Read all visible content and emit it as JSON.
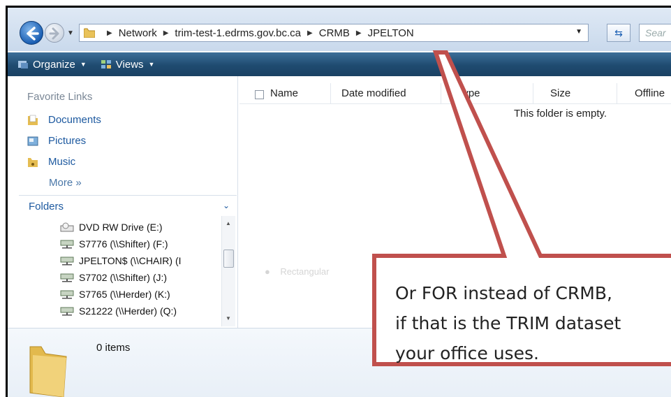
{
  "address_bar": {
    "breadcrumbs": [
      "Network",
      "trim-test-1.edrms.gov.bc.ca",
      "CRMB",
      "JPELTON"
    ],
    "search_placeholder": "Sear",
    "icons": [
      "back-arrow-icon",
      "forward-arrow-icon",
      "folder-icon",
      "refresh-icon"
    ]
  },
  "toolbar": {
    "organize_label": "Organize",
    "views_label": "Views"
  },
  "nav_pane": {
    "favorite_links_title": "Favorite Links",
    "favorites": [
      "Documents",
      "Pictures",
      "Music"
    ],
    "more_label": "More",
    "more_chevron": "»",
    "folders_label": "Folders",
    "tree": [
      "DVD RW Drive (E:)",
      "S7776 (\\\\Shifter) (F:)",
      "JPELTON$ (\\\\CHAIR) (I",
      "S7702 (\\\\Shifter) (J:)",
      "S7765 (\\\\Herder) (K:)",
      "S21222 (\\\\Herder) (Q:)"
    ]
  },
  "content": {
    "columns": [
      "Name",
      "Date modified",
      "Type",
      "Size",
      "Offline"
    ],
    "empty_message": "This folder is empty.",
    "ghost_text": "Rectangular"
  },
  "details_pane": {
    "item_count": "0 items"
  },
  "callout": {
    "lines": [
      "Or FOR instead of CRMB,",
      "if that is the TRIM dataset",
      "your office uses."
    ],
    "border_color": "#c0504d",
    "fill_color": "#ffffff"
  },
  "colors": {
    "toolbar": "#1f4b70",
    "link": "#1e5aa0"
  }
}
